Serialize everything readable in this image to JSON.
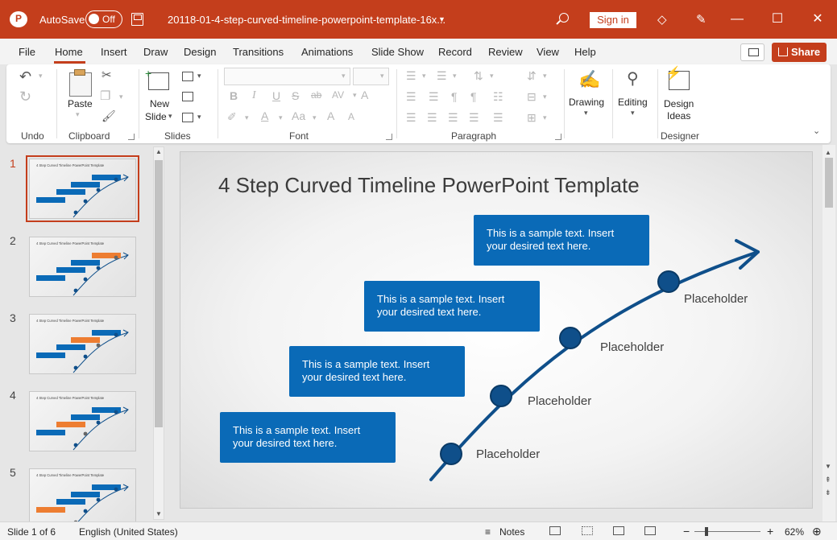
{
  "titlebar": {
    "autosave_label": "AutoSave",
    "autosave_state": "Off",
    "filename": "20118-01-4-step-curved-timeline-powerpoint-template-16x...",
    "signin": "Sign in"
  },
  "tabs": [
    "File",
    "Home",
    "Insert",
    "Draw",
    "Design",
    "Transitions",
    "Animations",
    "Slide Show",
    "Record",
    "Review",
    "View",
    "Help"
  ],
  "active_tab": "Home",
  "share_label": "Share",
  "ribbon": {
    "groups": {
      "undo": "Undo",
      "clipboard": "Clipboard",
      "slides": "Slides",
      "font": "Font",
      "paragraph": "Paragraph",
      "designer": "Designer"
    },
    "paste": "Paste",
    "new_slide_line1": "New",
    "new_slide_line2": "Slide",
    "drawing": "Drawing",
    "editing": "Editing",
    "design_ideas_line1": "Design",
    "design_ideas_line2": "Ideas",
    "font_buttons": [
      "B",
      "I",
      "U",
      "S",
      "ab",
      "AV"
    ]
  },
  "thumbnails": {
    "numbers": [
      "1",
      "2",
      "3",
      "4",
      "5"
    ],
    "selected": "1",
    "title": "4 Step Curved Timeline PowerPoint Template"
  },
  "slide": {
    "title": "4 Step Curved Timeline PowerPoint Template",
    "boxes": [
      "This is a sample text. Insert your desired text here.",
      "This is a sample text. Insert your desired text here.",
      "This is a sample text. Insert your desired text here.",
      "This is a sample text. Insert your desired text here."
    ],
    "placeholders": [
      "Placeholder",
      "Placeholder",
      "Placeholder",
      "Placeholder"
    ],
    "colors": {
      "box": "#0a6ab7",
      "curve": "#0f4f8a",
      "highlight": "#ed7d31"
    }
  },
  "status": {
    "slide_info": "Slide 1 of 6",
    "language": "English (United States)",
    "notes": "Notes",
    "zoom": "62%"
  },
  "colors": {
    "accent": "#c43e1c"
  }
}
